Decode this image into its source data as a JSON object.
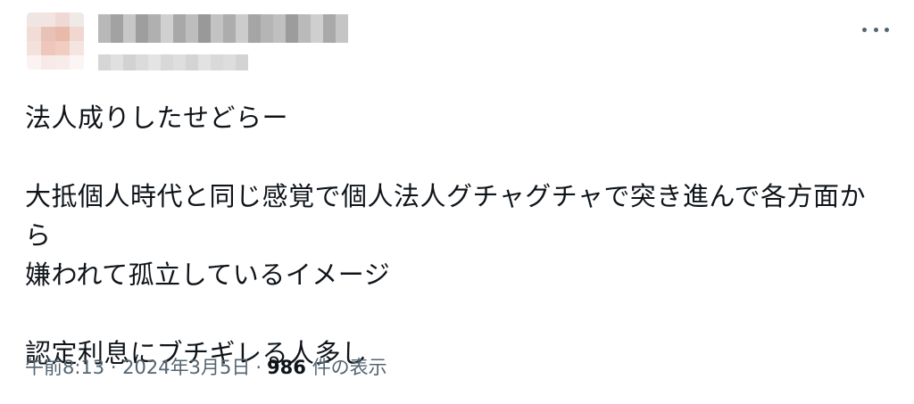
{
  "tweet": {
    "more_icon": "more-horizontal-icon",
    "text_lines": [
      "法人成りしたせどらー",
      "大抵個人時代と同じ感覚で個人法人グチャグチャで突き進んで各方面から",
      "嫌われて孤立しているイメージ",
      "認定利息にブチギレる人多し"
    ],
    "timestamp": "午前8:13 · 2024年3月5日",
    "separator": "·",
    "views_count": "986",
    "views_label": "件の表示"
  },
  "colors": {
    "text": "#0f1419",
    "secondary": "#536471"
  }
}
